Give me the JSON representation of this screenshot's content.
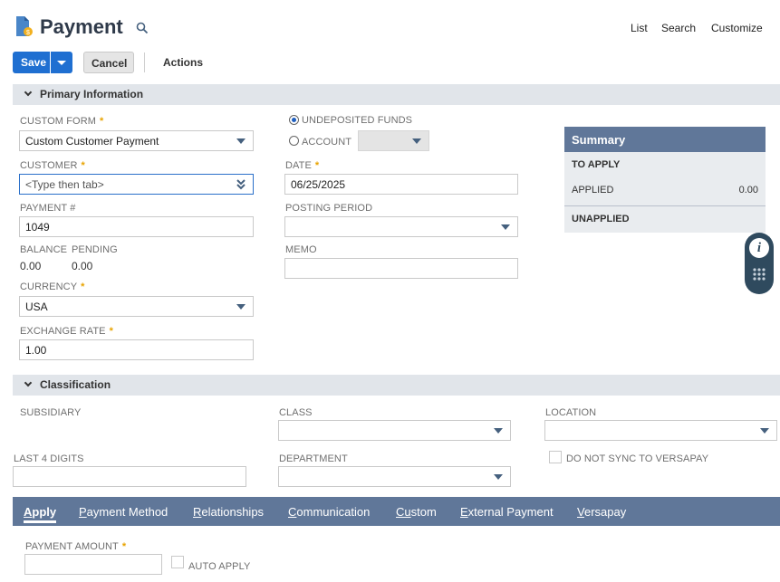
{
  "header": {
    "title": "Payment",
    "links": [
      "List",
      "Search",
      "Customize"
    ]
  },
  "toolbar": {
    "save_label": "Save",
    "cancel_label": "Cancel",
    "actions_label": "Actions"
  },
  "primary": {
    "section_title": "Primary Information",
    "custom_form_label": "CUSTOM FORM",
    "custom_form_value": "Custom Customer Payment",
    "customer_label": "CUSTOMER",
    "customer_placeholder": "<Type then tab>",
    "payment_no_label": "PAYMENT #",
    "payment_no_value": "1049",
    "balance_label": "BALANCE",
    "balance_value": "0.00",
    "pending_label": "PENDING",
    "pending_value": "0.00",
    "currency_label": "CURRENCY",
    "currency_value": "USA",
    "exchange_rate_label": "EXCHANGE RATE",
    "exchange_rate_value": "1.00",
    "undeposited_label": "UNDEPOSITED FUNDS",
    "account_label": "ACCOUNT",
    "date_label": "DATE",
    "date_value": "06/25/2025",
    "posting_period_label": "POSTING PERIOD",
    "memo_label": "MEMO"
  },
  "summary": {
    "title": "Summary",
    "to_apply": "TO APPLY",
    "applied_label": "APPLIED",
    "applied_value": "0.00",
    "unapplied": "UNAPPLIED"
  },
  "classification": {
    "section_title": "Classification",
    "subsidiary_label": "SUBSIDIARY",
    "class_label": "CLASS",
    "location_label": "LOCATION",
    "last4_label": "LAST 4 DIGITS",
    "department_label": "DEPARTMENT",
    "no_sync_label": "DO NOT SYNC TO VERSAPAY"
  },
  "tabs": [
    {
      "label": "Apply",
      "underline": "A",
      "rest": "pply"
    },
    {
      "label": "Payment Method",
      "underline": "P",
      "rest": "ayment Method"
    },
    {
      "label": "Relationships",
      "underline": "R",
      "rest": "elationships"
    },
    {
      "label": "Communication",
      "underline": "C",
      "rest": "ommunication"
    },
    {
      "label": "Custom",
      "underline": "Cu",
      "rest": "stom"
    },
    {
      "label": "External Payment",
      "underline": "E",
      "rest": "xternal Payment"
    },
    {
      "label": "Versapay",
      "underline": "V",
      "rest": "ersapay"
    }
  ],
  "apply_tab": {
    "payment_amount_label": "PAYMENT AMOUNT",
    "auto_apply_label": "AUTO APPLY"
  },
  "colors": {
    "primary_button": "#1f6fd1",
    "tab_bar": "#607799",
    "summary_header": "#607799",
    "required_marker": "#e8a300"
  }
}
